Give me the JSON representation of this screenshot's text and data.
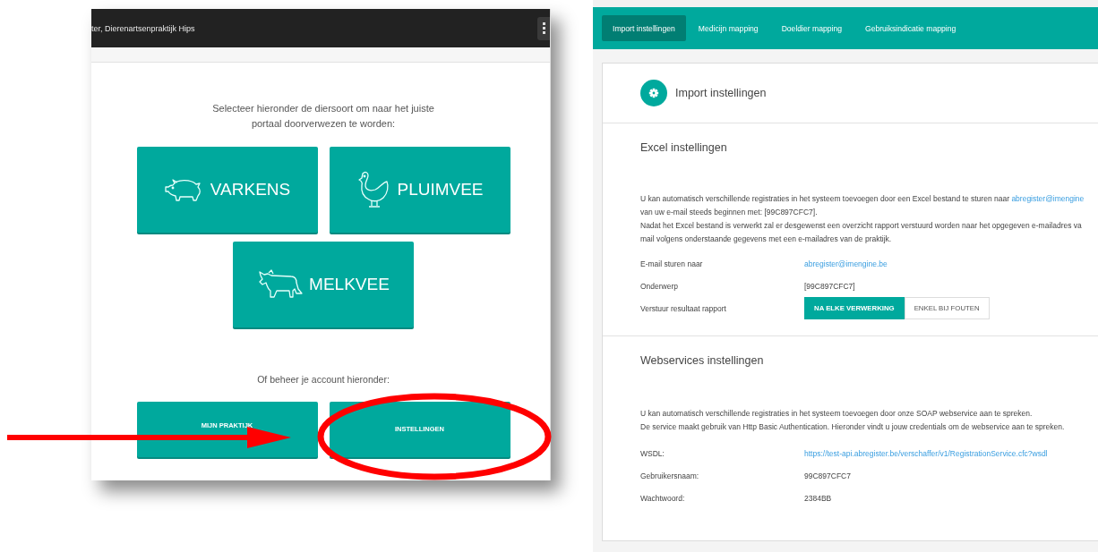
{
  "left_window": {
    "title": "ter, Dierenartsenpraktijk Hips",
    "intro_lines": [
      "Selecteer hieronder de diersoort om naar het juiste",
      "portaal doorverwezen te worden:"
    ],
    "species": [
      {
        "label": "VARKENS",
        "kind": "pig"
      },
      {
        "label": "PLUIMVEE",
        "kind": "chicken"
      },
      {
        "label": "MELKVEE",
        "kind": "cow"
      }
    ],
    "account_prompt": "Of beheer je account hieronder:",
    "account_buttons": [
      {
        "label": "MIJN PRAKTIJK",
        "highlighted": false
      },
      {
        "label": "INSTELLINGEN",
        "highlighted": true
      }
    ]
  },
  "right_window": {
    "tabs": [
      {
        "label": "Import instellingen",
        "selected": true
      },
      {
        "label": "Medicijn mapping",
        "selected": false
      },
      {
        "label": "Doeldier mapping",
        "selected": false
      },
      {
        "label": "Gebruiksindicatie mapping",
        "selected": false
      }
    ],
    "card_title": "Import instellingen",
    "excel": {
      "title": "Excel instellingen",
      "paragraph_lines": [
        {
          "text": "U kan automatisch verschillende registraties in het systeem toevoegen door een Excel bestand te sturen naar ",
          "link": "abregister@imengine"
        },
        {
          "text": "van uw e-mail steeds beginnen met: [99C897CFC7]."
        },
        {
          "text": "Nadat het Excel bestand is verwerkt zal er desgewenst een overzicht rapport verstuurd worden naar het opgegeven e-mailadres va"
        },
        {
          "text": "mail volgens onderstaande gegevens met een e-mailadres van de praktijk."
        }
      ],
      "fields": [
        {
          "label": "E-mail sturen naar",
          "value": "abregister@imengine.be",
          "kind": "link"
        },
        {
          "label": "Onderwerp",
          "value": "[99C897CFC7]",
          "kind": "text"
        }
      ],
      "report_label": "Verstuur resultaat rapport",
      "report_options": [
        {
          "label": "NA ELKE VERWERKING",
          "selected": true
        },
        {
          "label": "ENKEL BIJ FOUTEN",
          "selected": false
        }
      ]
    },
    "webservices": {
      "title": "Webservices instellingen",
      "paragraph_lines": [
        {
          "text": "U kan automatisch verschillende registraties in het systeem toevoegen door onze SOAP webservice aan te spreken."
        },
        {
          "text": "De service maakt gebruik van Http Basic Authentication. Hieronder vindt u jouw credentials om de webservice aan te spreken."
        }
      ],
      "fields": [
        {
          "label": "WSDL:",
          "value": "https://test-api.abregister.be/verschaffer/v1/RegistrationService.cfc?wsdl",
          "kind": "link"
        },
        {
          "label": "Gebruikersnaam:",
          "value": "99C897CFC7",
          "kind": "text"
        },
        {
          "label": "Wachtwoord:",
          "value": "2384BB",
          "kind": "text"
        }
      ]
    }
  }
}
